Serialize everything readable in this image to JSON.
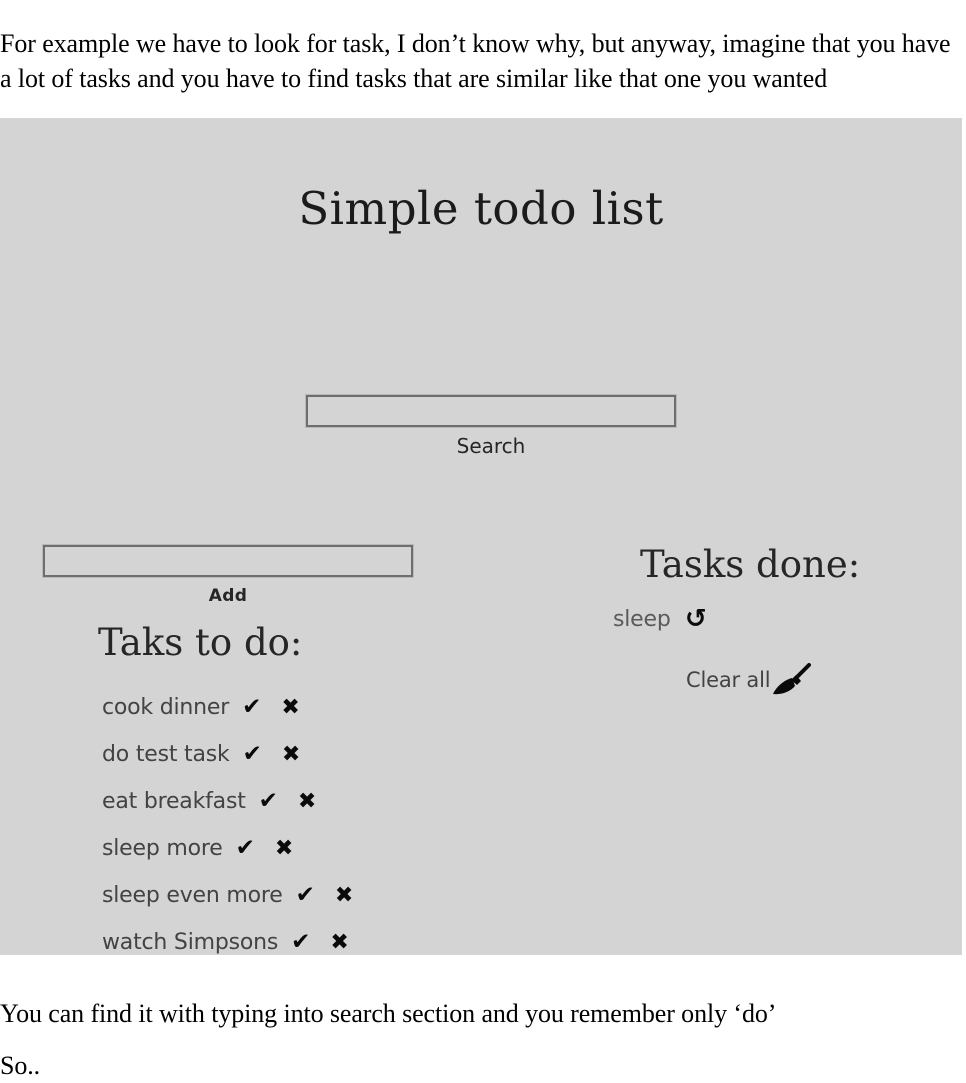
{
  "document": {
    "intro_paragraph": "For example we have to look for task, I don’t know why, but anyway, imagine that you have a lot of tasks and you have to find tasks that are similar like that one you wanted",
    "outro_line_1": "You can find it with typing into search section and you remember only ‘do’",
    "outro_line_2": "So.."
  },
  "app": {
    "title": "Simple todo list",
    "background_color": "#d4d4d4",
    "search": {
      "value": "",
      "placeholder": "",
      "label": "Search"
    },
    "add": {
      "value": "",
      "placeholder": "",
      "label": "Add"
    },
    "todo_section": {
      "heading": "Taks to do:",
      "items": [
        {
          "text": "cook dinner",
          "complete_icon": "check-icon",
          "complete_glyph": "✔",
          "delete_icon": "cross-icon",
          "delete_glyph": "✖"
        },
        {
          "text": "do test task",
          "complete_icon": "check-icon",
          "complete_glyph": "✔",
          "delete_icon": "cross-icon",
          "delete_glyph": "✖"
        },
        {
          "text": "eat breakfast",
          "complete_icon": "check-icon",
          "complete_glyph": "✔",
          "delete_icon": "cross-icon",
          "delete_glyph": "✖"
        },
        {
          "text": "sleep more",
          "complete_icon": "check-icon",
          "complete_glyph": "✔",
          "delete_icon": "cross-icon",
          "delete_glyph": "✖"
        },
        {
          "text": "sleep even more",
          "complete_icon": "check-icon",
          "complete_glyph": "✔",
          "delete_icon": "cross-icon",
          "delete_glyph": "✖"
        },
        {
          "text": "watch Simpsons",
          "complete_icon": "check-icon",
          "complete_glyph": "✔",
          "delete_icon": "cross-icon",
          "delete_glyph": "✖"
        }
      ]
    },
    "done_section": {
      "heading": "Tasks done:",
      "items": [
        {
          "text": "sleep",
          "undo_icon": "undo-arrow-icon",
          "undo_glyph": "↻"
        }
      ],
      "clear_all": {
        "label": "Clear all",
        "icon": "broom-icon"
      }
    }
  }
}
